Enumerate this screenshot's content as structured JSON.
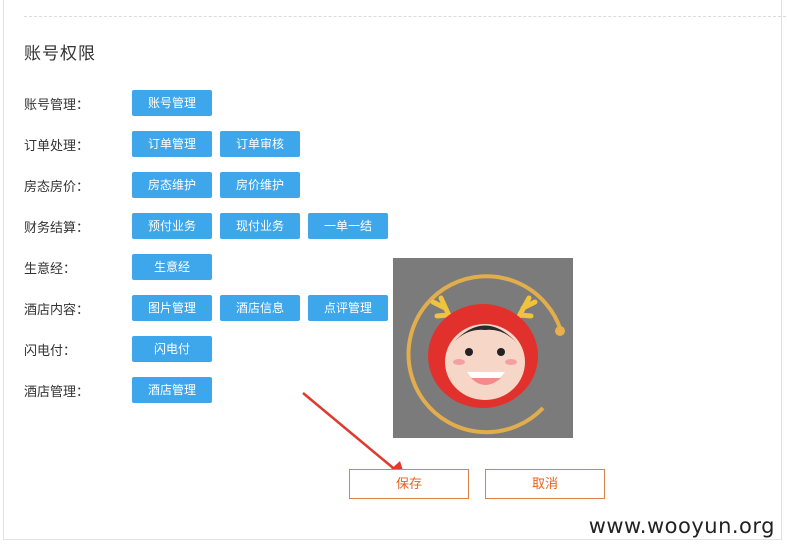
{
  "section": {
    "title": "账号权限"
  },
  "rows": [
    {
      "label": "账号管理：",
      "buttons": [
        "账号管理"
      ]
    },
    {
      "label": "订单处理：",
      "buttons": [
        "订单管理",
        "订单审核"
      ]
    },
    {
      "label": "房态房价：",
      "buttons": [
        "房态维护",
        "房价维护"
      ]
    },
    {
      "label": "财务结算：",
      "buttons": [
        "预付业务",
        "现付业务",
        "一单一结"
      ]
    },
    {
      "label": "生意经：",
      "buttons": [
        "生意经"
      ]
    },
    {
      "label": "酒店内容：",
      "buttons": [
        "图片管理",
        "酒店信息",
        "点评管理"
      ]
    },
    {
      "label": "闪电付：",
      "buttons": [
        "闪电付"
      ]
    },
    {
      "label": "酒店管理：",
      "buttons": [
        "酒店管理"
      ]
    }
  ],
  "actions": {
    "save": "保存",
    "cancel": "取消"
  },
  "watermark": "www.wooyun.org",
  "colors": {
    "primary_button": "#3ea6ea",
    "action_border": "#d9824a",
    "action_text": "#e5621c",
    "arrow": "#e03a2f"
  }
}
